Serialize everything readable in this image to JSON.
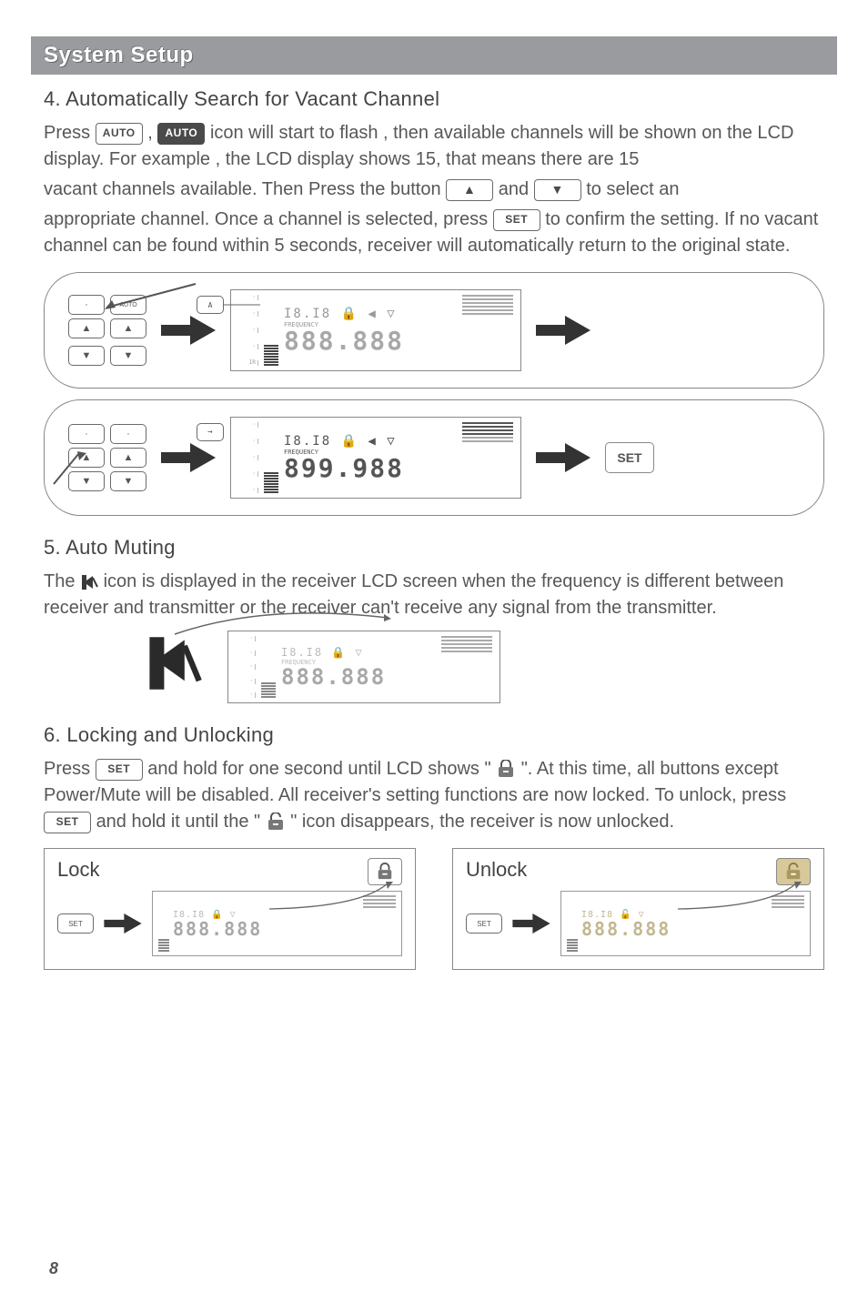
{
  "header": "System Setup",
  "section4": {
    "title": "4. Automatically Search for Vacant Channel",
    "p1a": "Press ",
    "button_auto": "AUTO",
    "p1b": " ,  ",
    "icon_auto": "AUTO",
    "p1c": " icon will start to flash , then  available channels will be shown on the LCD display. For example , the LCD display shows 15, that means there are 15",
    "p2a": "vacant channels available. Then Press the button ",
    "btn_up": "▲",
    "p2b": " and ",
    "btn_down": "▼",
    "p2c": " to select an",
    "p3a": "appropriate channel. Once a channel is selected, press ",
    "btn_set": "SET",
    "p3b": " to confirm the setting. If no vacant channel can be found within 5 seconds, receiver will automatically return to the original state."
  },
  "diagram1": {
    "remote_btn": "AUTO",
    "lcd_freq_dim": "888.888",
    "lcd_label": "FREQUENCY"
  },
  "diagram2": {
    "lcd_freq": "899.988",
    "lcd_label": "FREQUENCY",
    "set": "SET"
  },
  "section5": {
    "title": "5. Auto Muting",
    "p1a": "The ",
    "p1b": " icon  is  displayed  in  the  receiver  LCD  screen  when  the frequency  is  different  between  receiver  and  transmitter  or  the  receiver can't  receive  any  signal  from  the  transmitter.",
    "lcd_freq": "888.888",
    "lcd_label": "FREQUENCY"
  },
  "section6": {
    "title": "6. Locking and Unlocking",
    "p1a": "Press ",
    "btn_set": "SET",
    "p1b": " and  hold  for  one  second  until  LCD  shows \" ",
    "p1c": " \".  At  this  time, all  buttons  except  Power/Mute  will  be  disabled.  All receiver's setting functions are now  locked.   To  unlock,   press  ",
    "p1d": "  and  hold  it  until  the  \"",
    "p1e": "\" icon disappears, the  receiver  is  now  unlocked.",
    "lock_title": "Lock",
    "unlock_title": "Unlock",
    "lock_lcd_freq": "888.888",
    "btn_set2": "SET"
  },
  "page_num": "8"
}
